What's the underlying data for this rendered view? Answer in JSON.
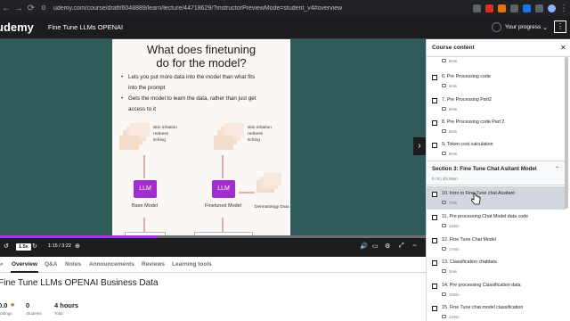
{
  "browser": {
    "url": "udemy.com/course/draft/6048889/learn/lecture/44718629/?instructorPreviewMode=student_v4#overview"
  },
  "header": {
    "logo": "udemy",
    "course_title": "Fine Tune LLMs OPENAI",
    "progress_label": "Your progress"
  },
  "slide": {
    "title_line1": "What does finetuning",
    "title_line2": "do for the model?",
    "bullet1_line1": "Lets you put more data into the model than what fits",
    "bullet1_line2": "into the prompt",
    "bullet2_line1": "Gets the model to learn the data, rather than just get",
    "bullet2_line2": "access to it",
    "doc_text_1": "skin irritation",
    "doc_text_2": "redness",
    "doc_text_3": "itching",
    "llm_label": "LLM",
    "base_caption": "Base Model",
    "finetuned_caption": "Finetuned Model",
    "derm_caption": "Dermatology Data"
  },
  "player": {
    "speed": "1.5x",
    "time": "1:15 / 3:22",
    "progress_fraction": 0.37
  },
  "tabs": [
    {
      "label": "Overview"
    },
    {
      "label": "Q&A"
    },
    {
      "label": "Notes"
    },
    {
      "label": "Announcements"
    },
    {
      "label": "Reviews"
    },
    {
      "label": "Learning tools"
    }
  ],
  "course_body": {
    "title": "Fine Tune LLMs OPENAI Business Data",
    "rating_value": "0.0",
    "rating_label": "ratings",
    "students_value": "0",
    "students_label": "Students",
    "hours_value": "4 hours",
    "hours_label": "Total"
  },
  "sidebar": {
    "title": "Course content",
    "lessons_before": [
      {
        "duration": "6min"
      },
      {
        "name": "6. Pre Processing code",
        "duration": "6min"
      },
      {
        "name": "7. Pre Processing Part2",
        "duration": "6min"
      },
      {
        "name": "8. Pre Processing code Part 2",
        "duration": "5min"
      },
      {
        "name": "9. Token cost calculation",
        "duration": "6min"
      }
    ],
    "section": {
      "title": "Section 3: Fine Tune Chat Asitant Model",
      "meta": "0 / 8 | 1hr 9min"
    },
    "lessons_after": [
      {
        "name": "10. Intro to Fine Tune chat Assitant",
        "duration": "7min"
      },
      {
        "name": "11. Pre processing Chat Model data code",
        "duration": "12min"
      },
      {
        "name": "12. Fine Tune Chat Model",
        "duration": "17min"
      },
      {
        "name": "13. Classification chatdata",
        "duration": "3min"
      },
      {
        "name": "14. Pre processing Classification data",
        "duration": "10min"
      },
      {
        "name": "15. Fine Tune chat model classification",
        "duration": "12min"
      }
    ]
  },
  "colors": {
    "accent": "#a435f0",
    "llm_box": "#a22ecb",
    "video_bg": "#2f5c5b",
    "header_bg": "#1c1d1f"
  }
}
